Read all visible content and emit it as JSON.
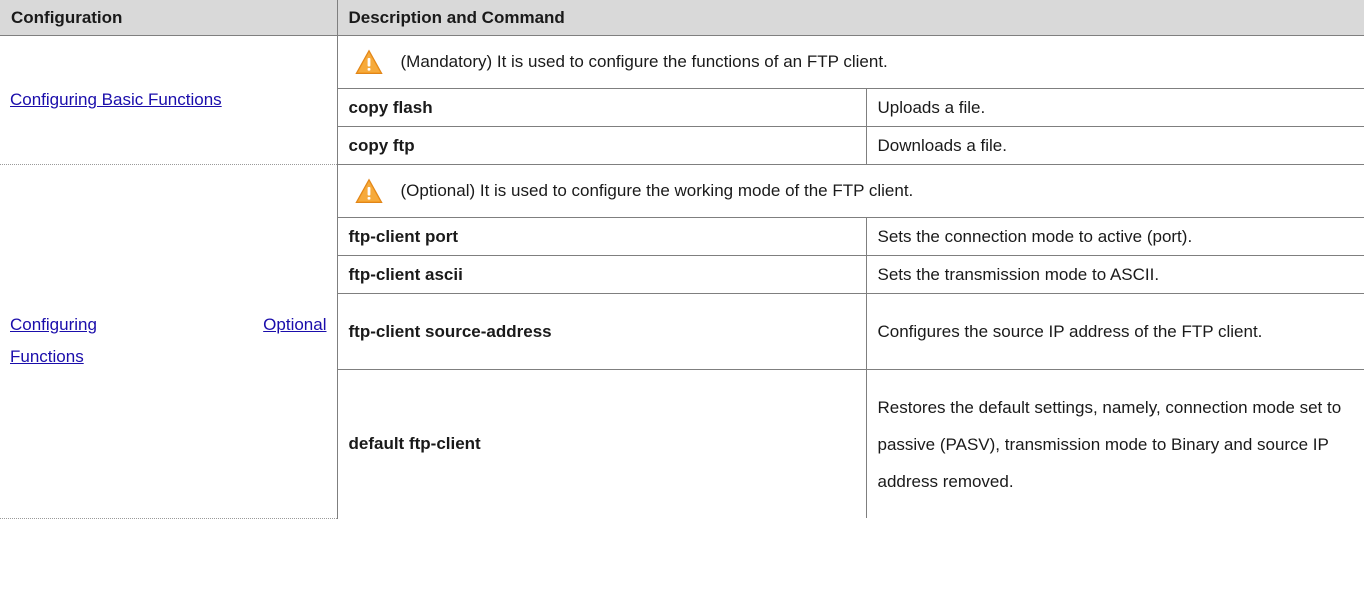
{
  "table": {
    "header": {
      "configuration": "Configuration",
      "description": "Description and Command"
    },
    "groups": [
      {
        "link": "Configuring Basic Functions",
        "notice": "(Mandatory) It is used to configure the functions of an FTP client.",
        "rows": [
          {
            "command": "copy flash",
            "description": "Uploads a file."
          },
          {
            "command": "copy ftp",
            "description": "Downloads a file."
          }
        ]
      },
      {
        "link_line1_a": "Configuring",
        "link_line1_b": "Optional",
        "link_line2": "Functions",
        "notice": "(Optional) It is used to configure the working mode of the FTP client.",
        "rows": [
          {
            "command": "ftp-client port",
            "description": "Sets the connection mode to active (port)."
          },
          {
            "command": "ftp-client ascii",
            "description": "Sets the transmission mode to ASCII."
          },
          {
            "command": "ftp-client source-address",
            "description": "Configures the source IP address of the FTP client."
          },
          {
            "command": "default ftp-client",
            "description": "Restores the default settings, namely, connection mode set to passive (PASV), transmission mode to Binary and source IP address removed."
          }
        ]
      }
    ]
  },
  "icons": {
    "warning": "warning-icon",
    "warning_color": "#f39a1e"
  }
}
